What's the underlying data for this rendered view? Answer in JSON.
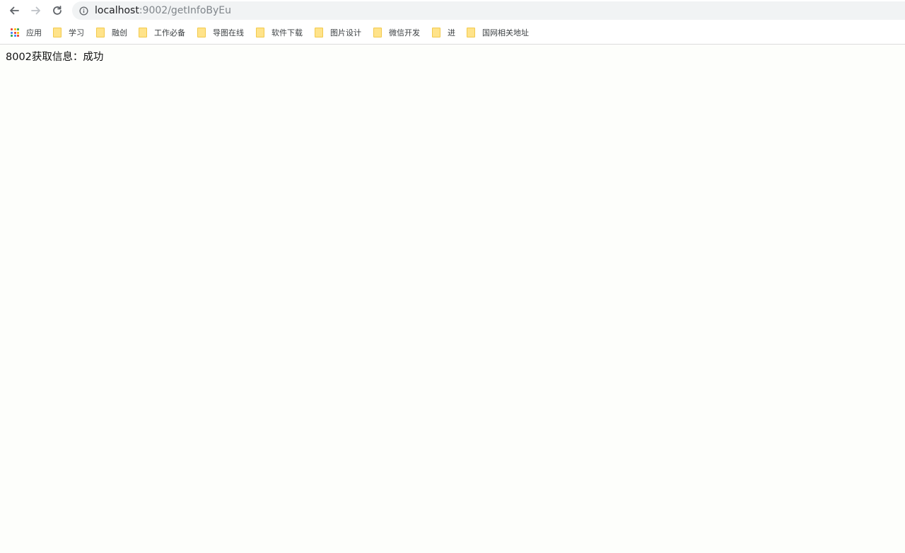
{
  "browser": {
    "url_host": "localhost",
    "url_path": ":9002/getInfoByEu"
  },
  "bookmarks": {
    "apps_label": "应用",
    "items": [
      {
        "label": "学习"
      },
      {
        "label": "融创"
      },
      {
        "label": "工作必备"
      },
      {
        "label": "导图在线"
      },
      {
        "label": "软件下载"
      },
      {
        "label": "图片设计"
      },
      {
        "label": "微信开发"
      },
      {
        "label": "进"
      },
      {
        "label": "国网相关地址"
      }
    ]
  },
  "page": {
    "message": "8002获取信息：成功"
  },
  "colors": {
    "page_background": "#fdfefb",
    "omnibox_background": "#f1f3f4",
    "folder_fill": "#ffe38a"
  }
}
